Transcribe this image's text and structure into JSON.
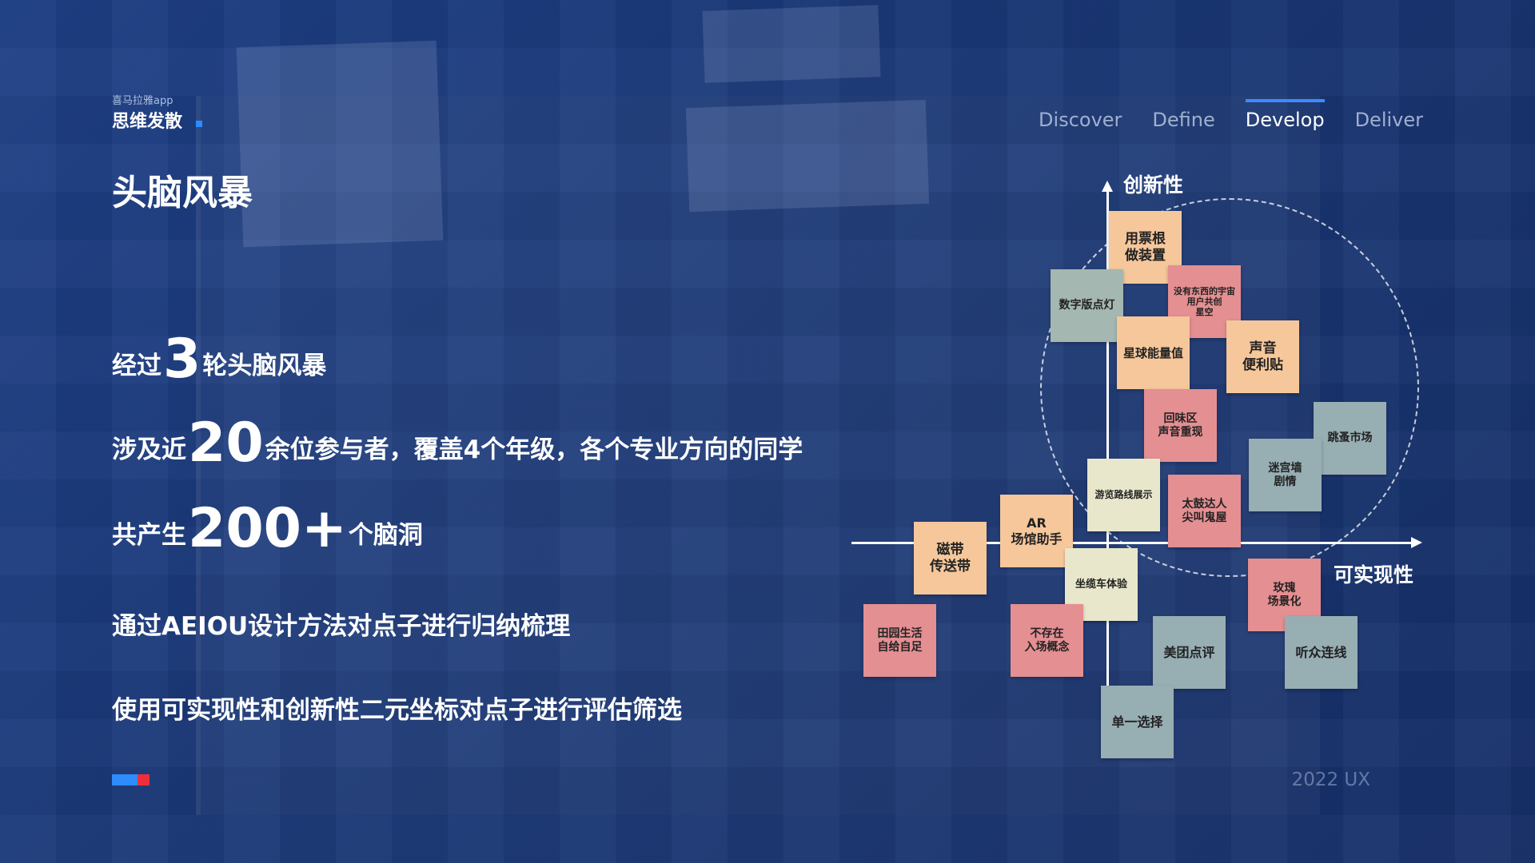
{
  "header": {
    "app_name": "喜马拉雅app",
    "section": "思维发散",
    "title": "头脑风暴"
  },
  "tabs": [
    {
      "label": "Discover",
      "active": false
    },
    {
      "label": "Define",
      "active": false
    },
    {
      "label": "Develop",
      "active": true
    },
    {
      "label": "Deliver",
      "active": false
    }
  ],
  "lines": [
    {
      "pre": "经过",
      "num": "3",
      "post": "轮头脑风暴"
    },
    {
      "pre": "涉及近",
      "num": "20",
      "post": "余位参与者，覆盖4个年级，各个专业方向的同学"
    },
    {
      "pre": "共产生",
      "num": "200+",
      "post": "个脑洞"
    },
    {
      "text": "通过AEIOU设计方法对点子进行归纳梳理"
    },
    {
      "text": "使用可实现性和创新性二元坐标对点子进行评估筛选"
    }
  ],
  "matrix": {
    "y_axis_label": "创新性",
    "x_axis_label": "可实现性",
    "notes": [
      "用票根\n做装置",
      "数字版点灯",
      "没有东西的宇宙\n用户共创\n星空",
      "星球能量值",
      "声音\n便利贴",
      "回味区\n声音重现",
      "跳蚤市场",
      "迷宫墙\n剧情",
      "游览路线展示",
      "太鼓达人\n尖叫鬼屋",
      "AR\n场馆助手",
      "磁带\n传送带",
      "坐缆车体验",
      "玫瑰\n场景化",
      "田园生活\n自给自足",
      "不存在\n入场概念",
      "美团点评",
      "听众连线",
      "单一选择"
    ]
  },
  "watermark": "2022 UX",
  "colors": {
    "background": "#1b3a7e",
    "accent_blue": "#2f8cff",
    "accent_red": "#ee2e3c",
    "note_orange": "#f5c79b",
    "note_pink": "#e48f92",
    "note_grey": "#a4b7b0",
    "note_cream": "#e8e7cb"
  }
}
